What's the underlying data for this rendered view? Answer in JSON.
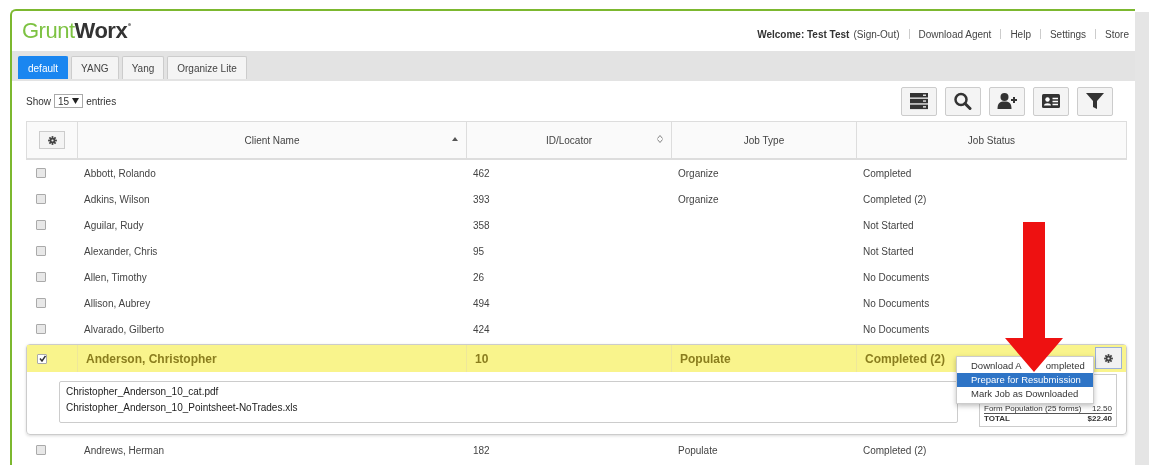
{
  "logo": {
    "part1": "Grunt",
    "part2": "Worx"
  },
  "top_links": {
    "welcome": "Welcome: Test Test",
    "sign_out": "(Sign-Out)",
    "links": [
      "Download Agent",
      "Help",
      "Settings",
      "Store"
    ]
  },
  "tabs": [
    {
      "label": "default",
      "selected": true
    },
    {
      "label": "YANG",
      "selected": false
    },
    {
      "label": "Yang",
      "selected": false
    },
    {
      "label": "Organize Lite",
      "selected": false
    }
  ],
  "show_entries": {
    "prefix": "Show",
    "value": "15",
    "suffix": "entries"
  },
  "table": {
    "columns": [
      {
        "label": "Client Name",
        "sortable": true,
        "sorted": true
      },
      {
        "label": "ID/Locator",
        "sortable": true,
        "sorted": false
      },
      {
        "label": "Job Type",
        "sortable": false,
        "sorted": false
      },
      {
        "label": "Job Status",
        "sortable": false,
        "sorted": false
      }
    ],
    "rows": [
      {
        "client": "Abbott, Rolando",
        "id": "462",
        "job_type": "Organize",
        "status": "Completed",
        "checked": false,
        "selected": false
      },
      {
        "client": "Adkins, Wilson",
        "id": "393",
        "job_type": "Organize",
        "status": "Completed (2)",
        "checked": false,
        "selected": false
      },
      {
        "client": "Aguilar, Rudy",
        "id": "358",
        "status": "Not Started",
        "checked": false,
        "selected": false
      },
      {
        "client": "Alexander, Chris",
        "id": "95",
        "status": "Not Started",
        "checked": false,
        "selected": false
      },
      {
        "client": "Allen, Timothy",
        "id": "26",
        "status": "No Documents",
        "checked": false,
        "selected": false
      },
      {
        "client": "Allison, Aubrey",
        "id": "494",
        "status": "No Documents",
        "checked": false,
        "selected": false
      },
      {
        "client": "Alvarado, Gilberto",
        "id": "424",
        "status": "No Documents",
        "checked": false,
        "selected": false
      },
      {
        "client": "Anderson, Christopher",
        "id": "10",
        "job_type": "Populate",
        "status": "Completed (2)",
        "checked": true,
        "selected": true,
        "files": [
          "Christopher_Anderson_10_cat.pdf",
          "Christopher_Anderson_10_Pointsheet-NoTrades.xls"
        ],
        "summary": [
          {
            "label": "Form Population (25 forms)",
            "amount": "12.50",
            "kind": "item"
          },
          {
            "label": "TOTAL",
            "amount": "$22.40",
            "kind": "total"
          }
        ],
        "menu": [
          {
            "label_start": "Download A",
            "label_end": "ompleted",
            "selected": false
          },
          {
            "label": "Prepare for Resubmission",
            "selected": true
          },
          {
            "label": "Mark Job as Downloaded",
            "selected": false
          }
        ]
      },
      {
        "client": "Andrews, Herman",
        "id": "182",
        "job_type": "Populate",
        "status": "Completed (2)",
        "checked": false,
        "selected": false
      }
    ]
  }
}
